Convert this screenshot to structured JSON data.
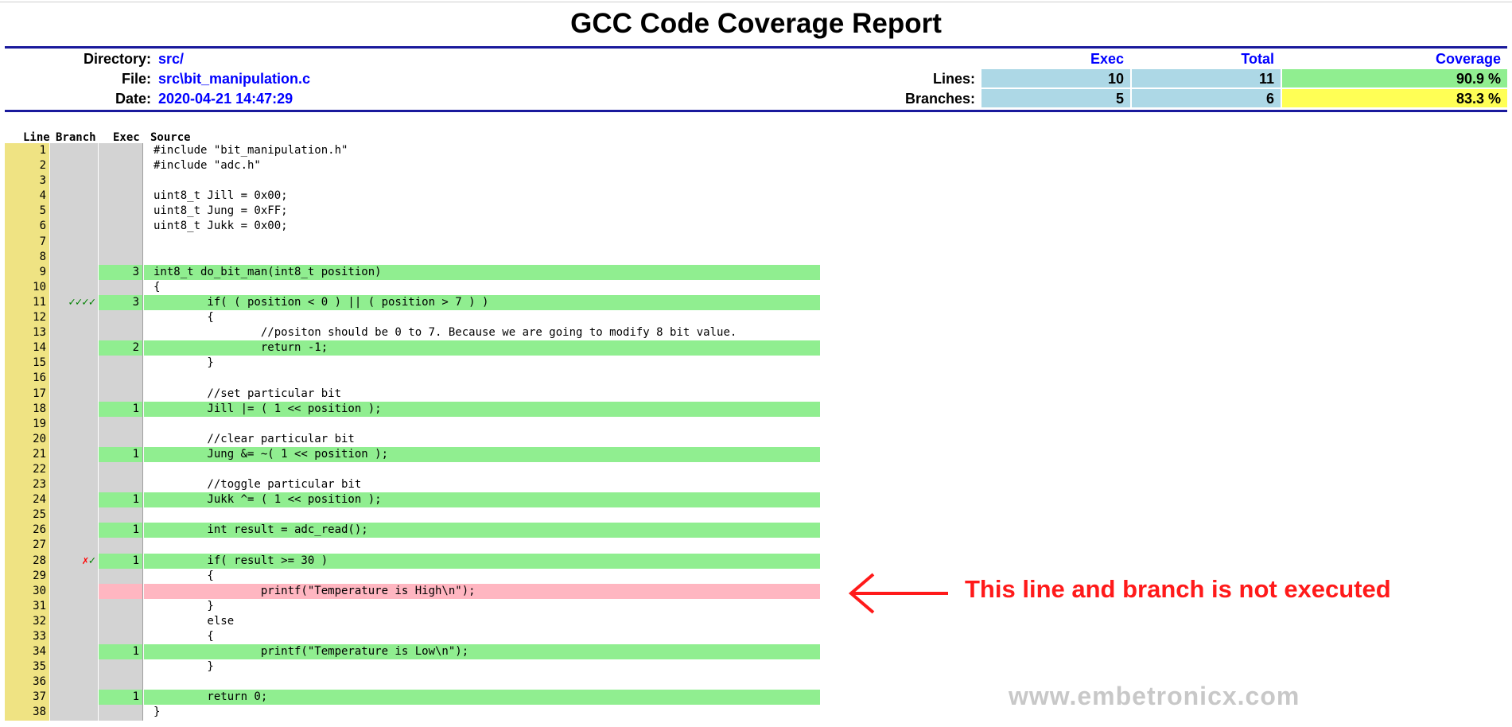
{
  "title": "GCC Code Coverage Report",
  "info": {
    "directory_label": "Directory:",
    "directory_value": "src/",
    "file_label": "File:",
    "file_value": "src\\bit_manipulation.c",
    "date_label": "Date:",
    "date_value": "2020-04-21 14:47:29"
  },
  "summary": {
    "headers": {
      "exec": "Exec",
      "total": "Total",
      "coverage": "Coverage"
    },
    "lines": {
      "label": "Lines:",
      "exec": "10",
      "total": "11",
      "coverage": "90.9 %",
      "coverage_color": "#90ee90"
    },
    "branches": {
      "label": "Branches:",
      "exec": "5",
      "total": "6",
      "coverage": "83.3 %",
      "coverage_color": "#ffff55"
    }
  },
  "table_headers": {
    "line": "Line",
    "branch": "Branch",
    "exec": "Exec",
    "source": "Source"
  },
  "colors": {
    "covered": "#90ee90",
    "uncovered": "#ffb6c1",
    "line_col": "#efe383",
    "neutral": "#d3d3d3",
    "branch_taken": "#008000",
    "branch_not_taken": "#ff0000"
  },
  "source_lines": [
    {
      "line": "1",
      "branch": "",
      "exec": "",
      "status": "none",
      "source": "#include \"bit_manipulation.h\""
    },
    {
      "line": "2",
      "branch": "",
      "exec": "",
      "status": "none",
      "source": "#include \"adc.h\""
    },
    {
      "line": "3",
      "branch": "",
      "exec": "",
      "status": "none",
      "source": ""
    },
    {
      "line": "4",
      "branch": "",
      "exec": "",
      "status": "none",
      "source": "uint8_t Jill = 0x00;"
    },
    {
      "line": "5",
      "branch": "",
      "exec": "",
      "status": "none",
      "source": "uint8_t Jung = 0xFF;"
    },
    {
      "line": "6",
      "branch": "",
      "exec": "",
      "status": "none",
      "source": "uint8_t Jukk = 0x00;"
    },
    {
      "line": "7",
      "branch": "",
      "exec": "",
      "status": "none",
      "source": ""
    },
    {
      "line": "8",
      "branch": "",
      "exec": "",
      "status": "none",
      "source": ""
    },
    {
      "line": "9",
      "branch": "",
      "exec": "3",
      "status": "covered",
      "source": "int8_t do_bit_man(int8_t position)"
    },
    {
      "line": "10",
      "branch": "",
      "exec": "",
      "status": "none",
      "source": "{"
    },
    {
      "line": "11",
      "branch": "✓✓✓✓",
      "branch_state": "taken",
      "exec": "3",
      "status": "covered",
      "source": "        if( ( position < 0 ) || ( position > 7 ) )"
    },
    {
      "line": "12",
      "branch": "",
      "exec": "",
      "status": "none",
      "source": "        {"
    },
    {
      "line": "13",
      "branch": "",
      "exec": "",
      "status": "none",
      "source": "                //positon should be 0 to 7. Because we are going to modify 8 bit value."
    },
    {
      "line": "14",
      "branch": "",
      "exec": "2",
      "status": "covered",
      "source": "                return -1;"
    },
    {
      "line": "15",
      "branch": "",
      "exec": "",
      "status": "none",
      "source": "        }"
    },
    {
      "line": "16",
      "branch": "",
      "exec": "",
      "status": "none",
      "source": ""
    },
    {
      "line": "17",
      "branch": "",
      "exec": "",
      "status": "none",
      "source": "        //set particular bit"
    },
    {
      "line": "18",
      "branch": "",
      "exec": "1",
      "status": "covered",
      "source": "        Jill |= ( 1 << position );"
    },
    {
      "line": "19",
      "branch": "",
      "exec": "",
      "status": "none",
      "source": ""
    },
    {
      "line": "20",
      "branch": "",
      "exec": "",
      "status": "none",
      "source": "        //clear particular bit"
    },
    {
      "line": "21",
      "branch": "",
      "exec": "1",
      "status": "covered",
      "source": "        Jung &= ~( 1 << position );"
    },
    {
      "line": "22",
      "branch": "",
      "exec": "",
      "status": "none",
      "source": ""
    },
    {
      "line": "23",
      "branch": "",
      "exec": "",
      "status": "none",
      "source": "        //toggle particular bit"
    },
    {
      "line": "24",
      "branch": "",
      "exec": "1",
      "status": "covered",
      "source": "        Jukk ^= ( 1 << position );"
    },
    {
      "line": "25",
      "branch": "",
      "exec": "",
      "status": "none",
      "source": ""
    },
    {
      "line": "26",
      "branch": "",
      "exec": "1",
      "status": "covered",
      "source": "        int result = adc_read();"
    },
    {
      "line": "27",
      "branch": "",
      "exec": "",
      "status": "none",
      "source": ""
    },
    {
      "line": "28",
      "branch_not": "✗",
      "branch": "✓",
      "branch_state": "mixed",
      "exec": "1",
      "status": "covered",
      "source": "        if( result >= 30 )"
    },
    {
      "line": "29",
      "branch": "",
      "exec": "",
      "status": "none",
      "source": "        {"
    },
    {
      "line": "30",
      "branch": "",
      "exec": "",
      "status": "uncovered",
      "source": "                printf(\"Temperature is High\\n\");"
    },
    {
      "line": "31",
      "branch": "",
      "exec": "",
      "status": "none",
      "source": "        }"
    },
    {
      "line": "32",
      "branch": "",
      "exec": "",
      "status": "none",
      "source": "        else"
    },
    {
      "line": "33",
      "branch": "",
      "exec": "",
      "status": "none",
      "source": "        {"
    },
    {
      "line": "34",
      "branch": "",
      "exec": "1",
      "status": "covered",
      "source": "                printf(\"Temperature is Low\\n\");"
    },
    {
      "line": "35",
      "branch": "",
      "exec": "",
      "status": "none",
      "source": "        }"
    },
    {
      "line": "36",
      "branch": "",
      "exec": "",
      "status": "none",
      "source": ""
    },
    {
      "line": "37",
      "branch": "",
      "exec": "1",
      "status": "covered",
      "source": "        return 0;"
    },
    {
      "line": "38",
      "branch": "",
      "exec": "",
      "status": "none",
      "source": "}"
    }
  ],
  "annotation": {
    "text": "This line and branch is not executed",
    "color": "#ff1a1a"
  },
  "watermark": "www.embetronicx.com"
}
